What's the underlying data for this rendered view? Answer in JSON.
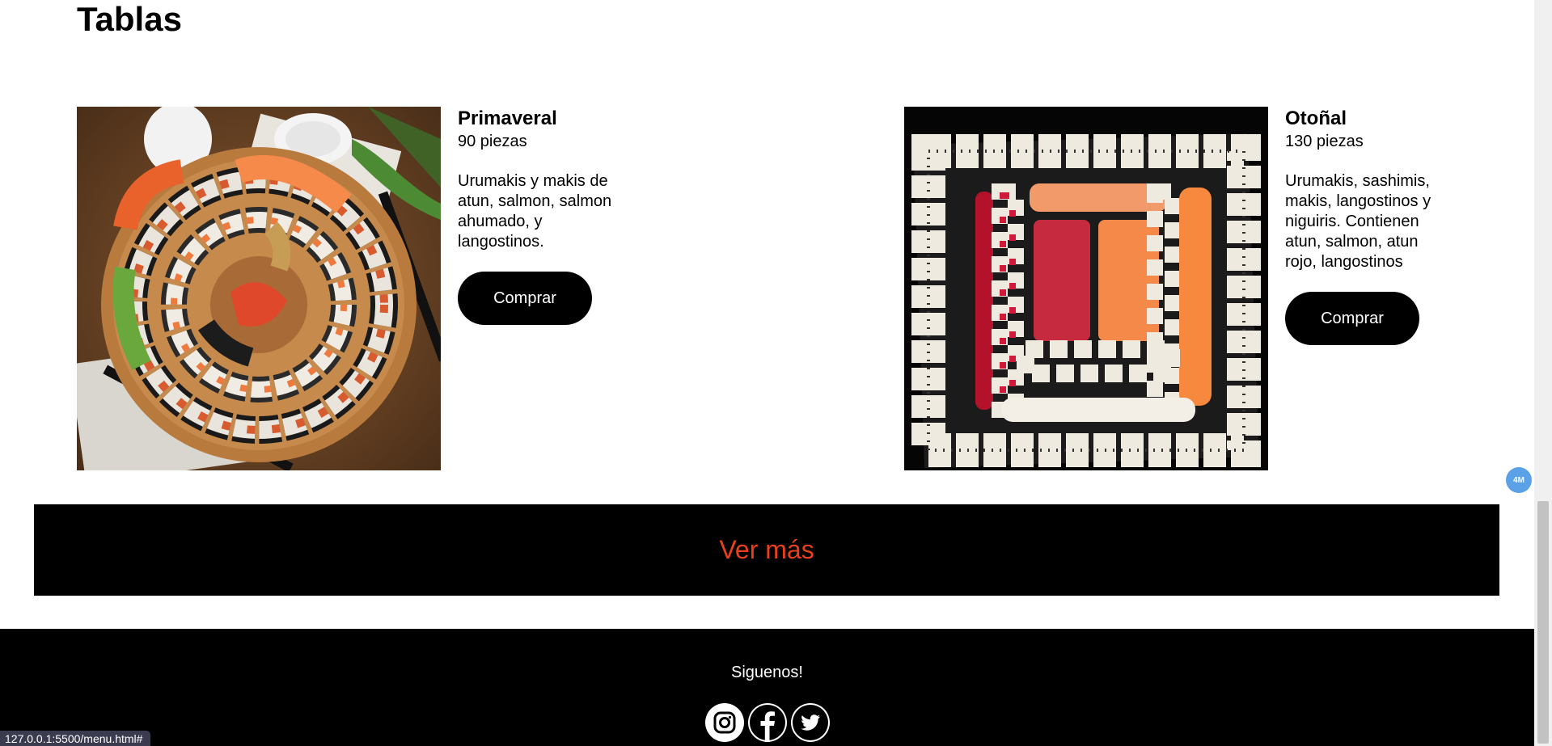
{
  "section": {
    "title": "Tablas"
  },
  "products": [
    {
      "name": "Primaveral",
      "pieces": "90 piezas",
      "description": "Urumakis y makis de atun, salmon, salmon ahumado, y langostinos.",
      "button_label": "Comprar",
      "image_icon": "sushi-platter-round-image"
    },
    {
      "name": "Otoñal",
      "pieces": "130 piezas",
      "description": "Urumakis, sashimis, makis, langostinos y niguiris. Contienen atun, salmon, atun rojo, langostinos",
      "button_label": "Comprar",
      "image_icon": "sushi-platter-square-image"
    }
  ],
  "ver_mas": {
    "label": "Ver más",
    "color": "#e8401c"
  },
  "footer": {
    "follow_label": "Siguenos!",
    "socials": [
      "instagram-icon",
      "facebook-icon",
      "twitter-icon"
    ]
  },
  "status_bar": {
    "url": "127.0.0.1:5500/menu.html#"
  },
  "extension_badge": {
    "label": "4M",
    "color": "#5aa1e8"
  }
}
